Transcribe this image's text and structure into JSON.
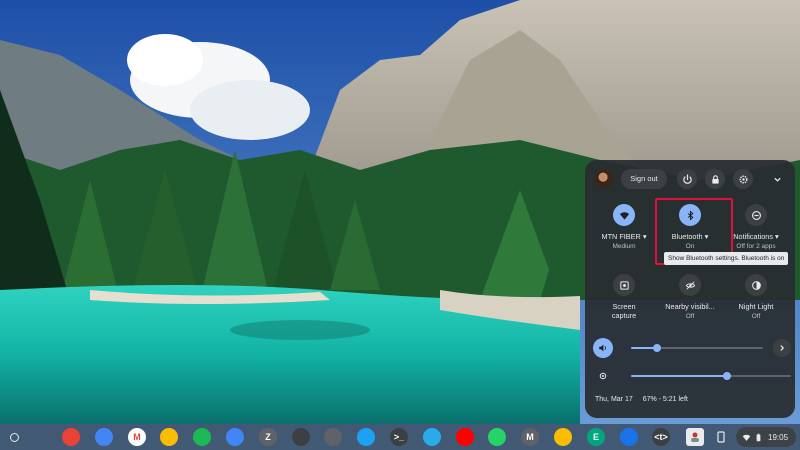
{
  "quick_settings": {
    "sign_out_label": "Sign out",
    "tiles": [
      {
        "label": "MTN FIBER",
        "sub": "Medium",
        "icon": "wifi-icon",
        "active": true,
        "has_menu": true
      },
      {
        "label": "Bluetooth",
        "sub": "On",
        "icon": "bluetooth-icon",
        "active": true,
        "has_menu": true
      },
      {
        "label": "Notifications",
        "sub": "Off for 2 apps",
        "icon": "do-not-disturb-icon",
        "active": false,
        "has_menu": true
      },
      {
        "label": "Screen capture",
        "label_line1": "Screen",
        "label_line2": "capture",
        "sub": "",
        "icon": "screen-capture-icon",
        "active": false
      },
      {
        "label": "Nearby visibil...",
        "sub": "Off",
        "icon": "nearby-share-icon",
        "active": false
      },
      {
        "label": "Night Light",
        "sub": "Off",
        "icon": "night-light-icon",
        "active": false
      }
    ],
    "tooltip": "Show Bluetooth settings. Bluetooth is on",
    "volume_level": 0.2,
    "brightness_level": 0.6,
    "footer_date": "Thu, Mar 17",
    "footer_battery": "67% - 5:21 left",
    "accent_color": "#8ab4f8",
    "highlight_color": "#e0103b"
  },
  "shelf": {
    "time": "19:05",
    "apps": [
      {
        "name": "chrome-icon",
        "letter": "",
        "color": "#ea4335"
      },
      {
        "name": "files-icon",
        "letter": "",
        "color": "#4285f4"
      },
      {
        "name": "gmail-icon",
        "letter": "M",
        "color": "#ffffff"
      },
      {
        "name": "drive-icon",
        "letter": "",
        "color": "#fbbc04"
      },
      {
        "name": "spotify-icon",
        "letter": "",
        "color": "#1db954"
      },
      {
        "name": "docs-icon",
        "letter": "",
        "color": "#4285f4"
      },
      {
        "name": "zoom-z-icon",
        "letter": "Z",
        "color": "#5f6368"
      },
      {
        "name": "loading-icon",
        "letter": "",
        "color": "#3c4043"
      },
      {
        "name": "settings-icon",
        "letter": "",
        "color": "#5f6368"
      },
      {
        "name": "twitter-icon",
        "letter": "",
        "color": "#1da1f2"
      },
      {
        "name": "terminal-icon",
        "letter": ">_",
        "color": "#3c4043"
      },
      {
        "name": "telegram-icon",
        "letter": "",
        "color": "#2aabee"
      },
      {
        "name": "youtube-icon",
        "letter": "",
        "color": "#ff0000"
      },
      {
        "name": "whatsapp-icon",
        "letter": "",
        "color": "#25d366"
      },
      {
        "name": "m-app-icon",
        "letter": "M",
        "color": "#5f6368"
      },
      {
        "name": "photos-icon",
        "letter": "",
        "color": "#fbbc04"
      },
      {
        "name": "e-app-icon",
        "letter": "E",
        "color": "#00a67e"
      },
      {
        "name": "pointer-app-icon",
        "letter": "",
        "color": "#1a73e8"
      },
      {
        "name": "code-app-icon",
        "letter": "<t>",
        "color": "#3c4043"
      }
    ]
  }
}
